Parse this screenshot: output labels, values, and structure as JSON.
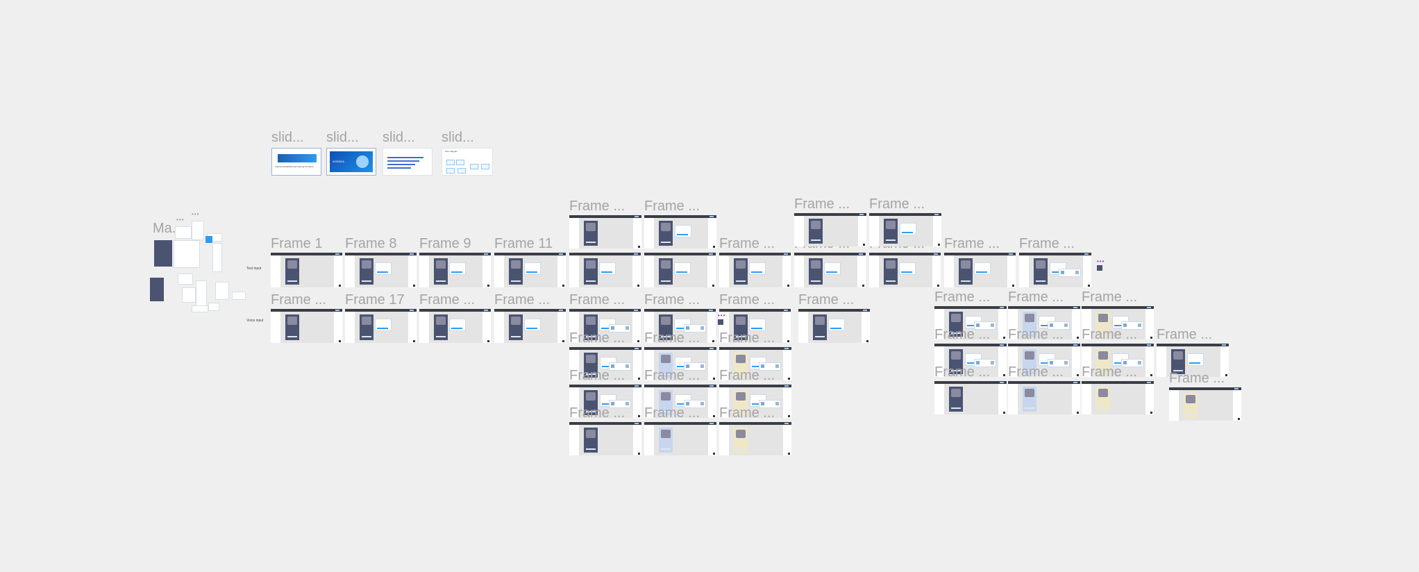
{
  "colors": {
    "canvas": "#efefef",
    "frame_label": "#a4a4a4",
    "frame_topbar": "#3a3d45",
    "accent": "#2f9bf0",
    "selection": "#8a2be2"
  },
  "slides": [
    {
      "label": "slid...",
      "variant": "title-light",
      "content": "Improved feedback and training for Figma"
    },
    {
      "label": "slid...",
      "variant": "title-blue",
      "content": "AGENDA"
    },
    {
      "label": "slid...",
      "variant": "text",
      "content": ""
    },
    {
      "label": "slid...",
      "variant": "diagram",
      "content": "Flow diagram"
    }
  ],
  "overview": {
    "label": "Ma..."
  },
  "row_labels": {
    "row1": "Text input",
    "row2": "Voice input"
  },
  "row1_frames": [
    "Frame 1",
    "Frame 8",
    "Frame 9",
    "Frame 11",
    "Frame ...",
    "Frame ...",
    "Frame ...",
    "Frame ...",
    "Frame ...",
    "Frame ...",
    "Frame ..."
  ],
  "row2_frames": [
    "Frame ...",
    "Frame 17",
    "Frame ...",
    "Frame ...",
    "Frame ...",
    "Frame ...",
    "Frame ...",
    "Frame ..."
  ],
  "top_frames": [
    "Frame ...",
    "Frame ...",
    "Frame ...",
    "Frame ..."
  ],
  "grid_frames": [
    "Frame ...",
    "Frame ...",
    "Frame ...",
    "Frame ...",
    "Frame ...",
    "Frame ...",
    "Frame ...",
    "Frame ...",
    "Frame ..."
  ],
  "right_grid_frames": [
    "Frame ...",
    "Frame ...",
    "Frame ...",
    "Frame ...",
    "Frame ...",
    "Frame ...",
    "Frame ...",
    "Frame ...",
    "Frame ...",
    "Frame ...",
    "Frame ..."
  ]
}
